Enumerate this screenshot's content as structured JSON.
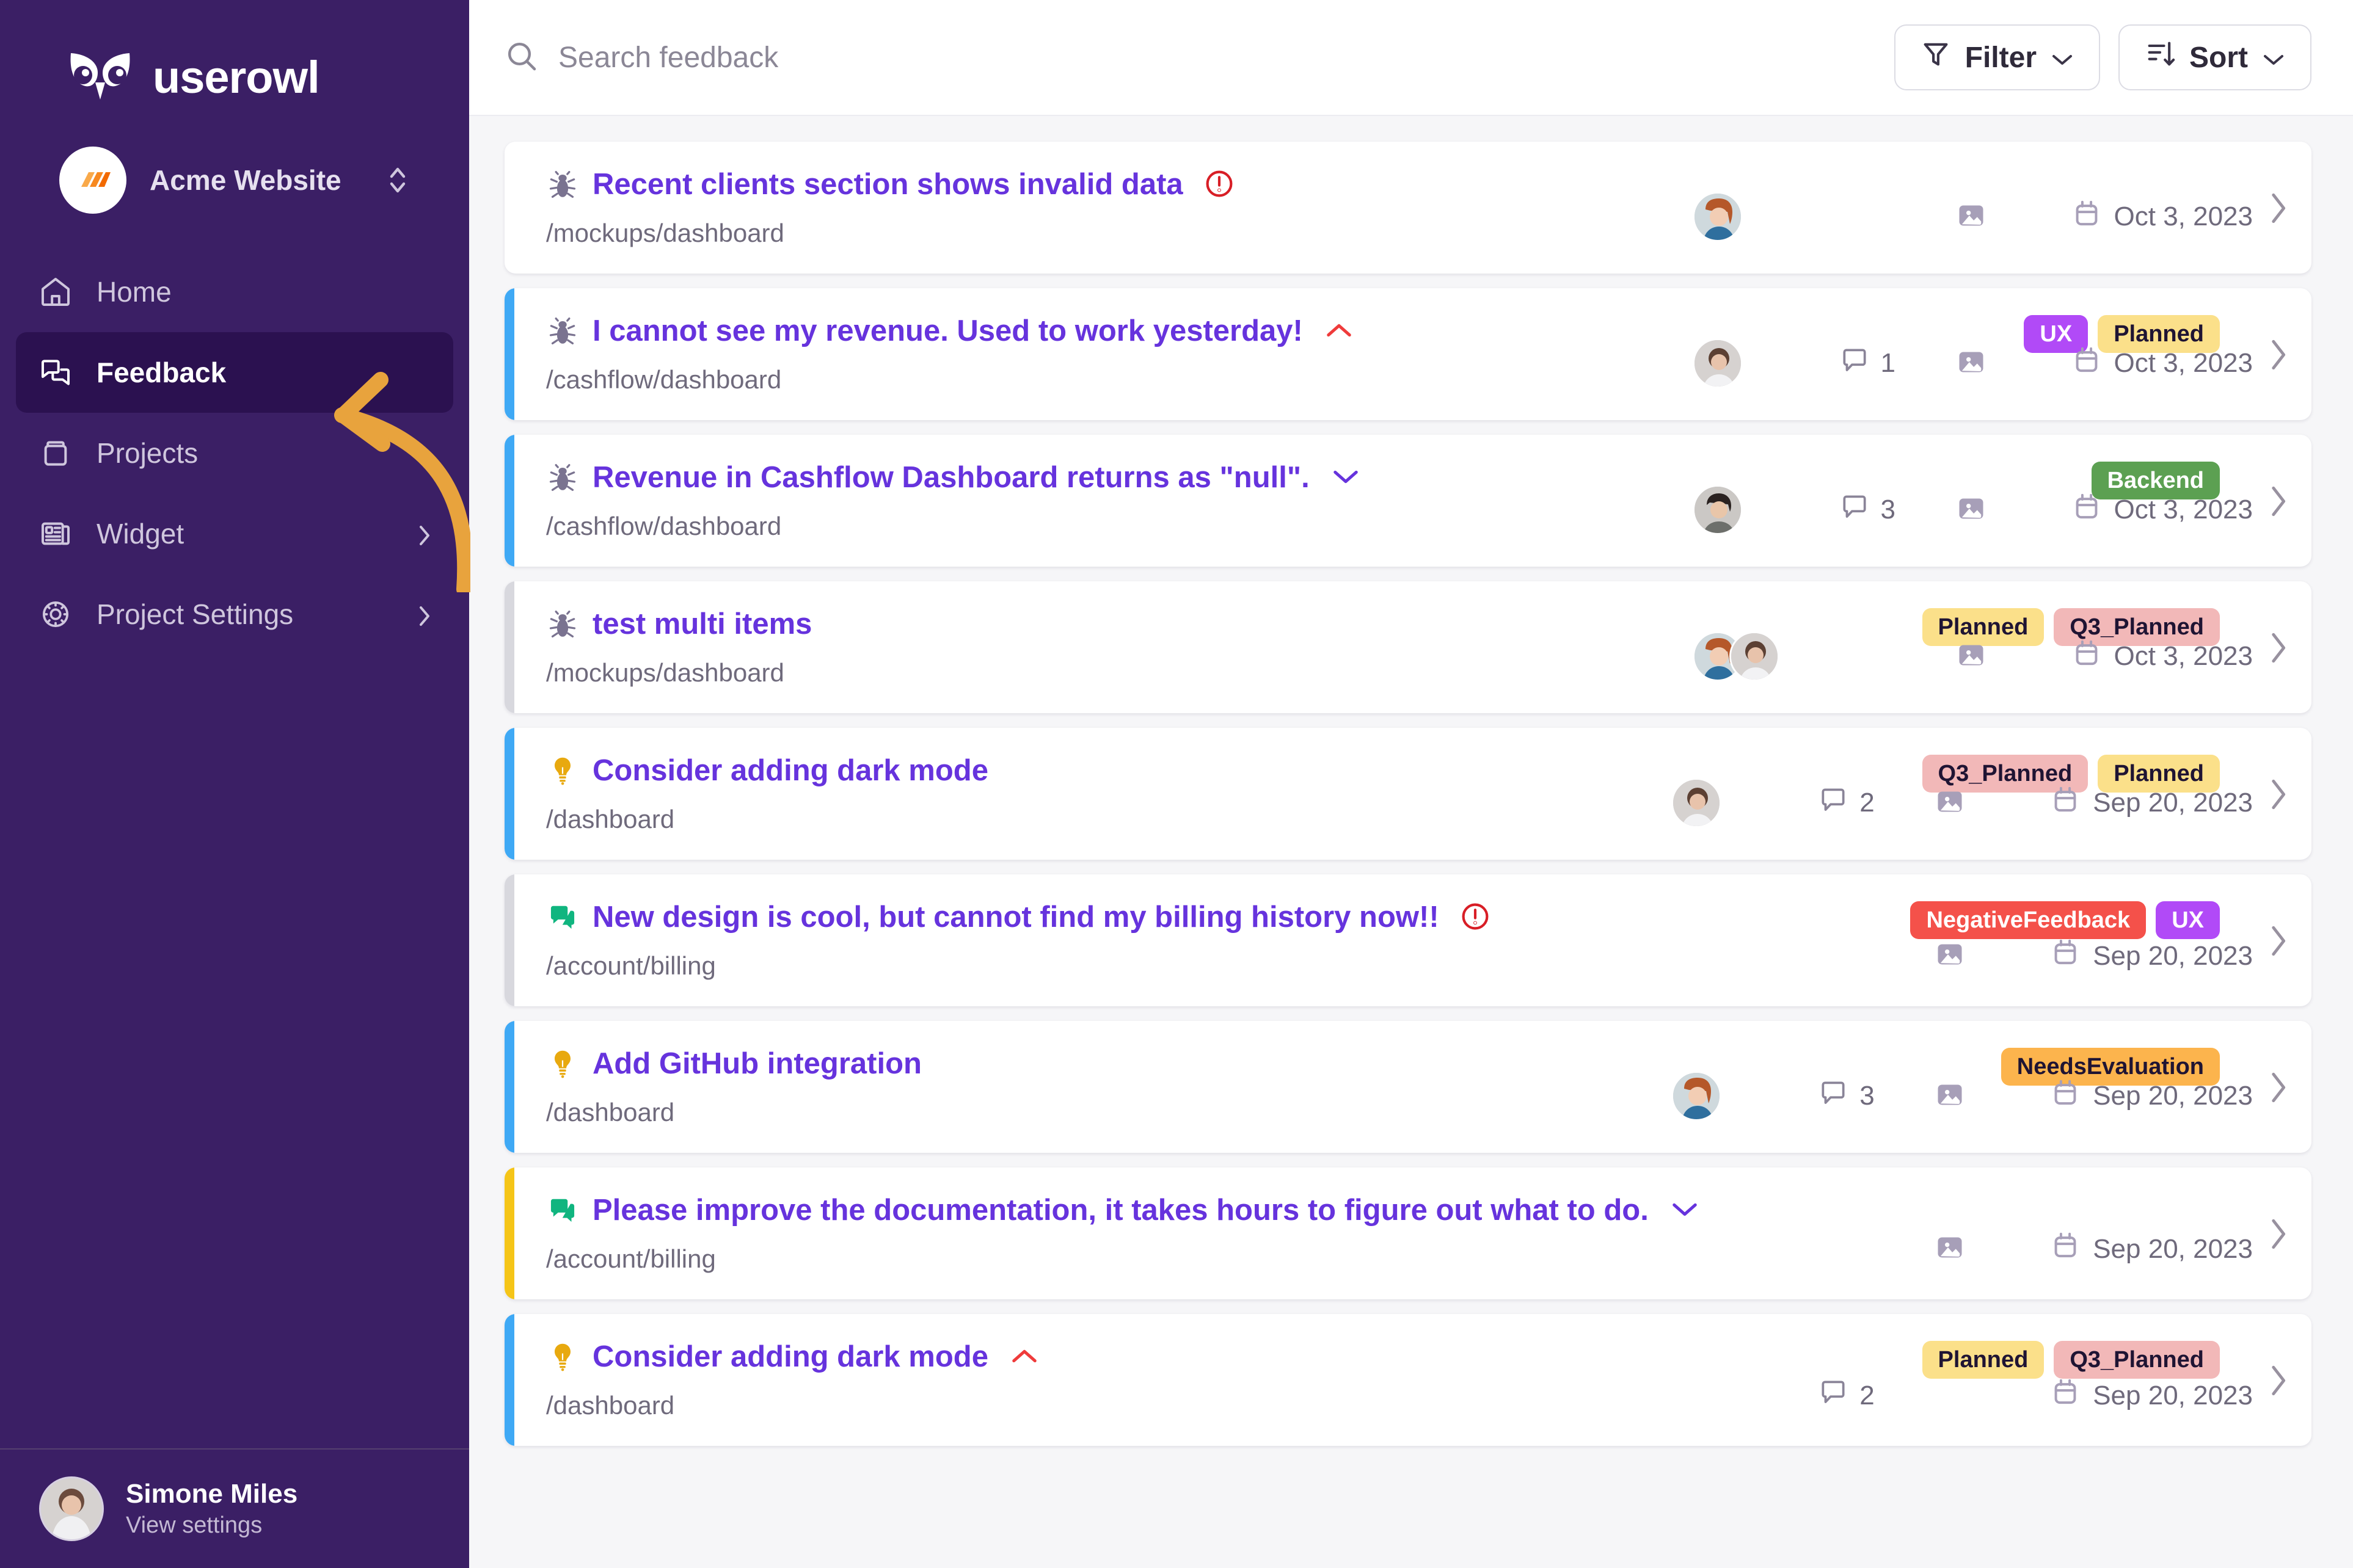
{
  "brand": {
    "name": "userowl",
    "logo_icon": "owl-logo"
  },
  "project_switcher": {
    "name": "Acme Website",
    "icon": "project-avatar-icon",
    "chevrons_icon": "chevron-up-down-icon"
  },
  "sidebar": {
    "items": [
      {
        "label": "Home",
        "icon": "home-icon",
        "active": false,
        "has_caret": false
      },
      {
        "label": "Feedback",
        "icon": "feedback-chat-icon",
        "active": true,
        "has_caret": false
      },
      {
        "label": "Projects",
        "icon": "projects-box-icon",
        "active": false,
        "has_caret": false
      },
      {
        "label": "Widget",
        "icon": "widget-card-icon",
        "active": false,
        "has_caret": true
      },
      {
        "label": "Project Settings",
        "icon": "gear-icon",
        "active": false,
        "has_caret": true
      }
    ]
  },
  "user": {
    "name": "Simone Miles",
    "subtitle": "View settings",
    "avatar_icon": "user-avatar"
  },
  "topbar": {
    "search_placeholder": "Search feedback",
    "search_value": "",
    "search_icon": "search-icon",
    "filter_label": "Filter",
    "filter_icon": "filter-funnel-icon",
    "sort_label": "Sort",
    "sort_icon": "sort-arrow-icon",
    "chevron_icon": "chevron-down-icon"
  },
  "colors": {
    "sidebar_bg": "#3b1f65",
    "sidebar_active_bg": "#2b1150",
    "title_purple": "#6633dd",
    "accent_blue": "#3fa9f5",
    "accent_yellow": "#f5c518",
    "accent_grey": "#d8d8de",
    "annotation_arrow": "#e8a33d"
  },
  "tag_styles": {
    "UX": {
      "bg": "#b14af7",
      "fg": "#ffffff"
    },
    "Planned": {
      "bg": "#fbe08a",
      "fg": "#1f1433"
    },
    "Backend": {
      "bg": "#5ca052",
      "fg": "#ffffff"
    },
    "Q3_Planned": {
      "bg": "#f2b8b8",
      "fg": "#1f1433"
    },
    "NegativeFeedback": {
      "bg": "#f4514a",
      "fg": "#ffffff"
    },
    "NeedsEvaluation": {
      "bg": "#fcb44d",
      "fg": "#1f1433"
    }
  },
  "feedback_items": [
    {
      "title": "Recent clients section shows invalid data",
      "type_icon": "bug-icon",
      "path": "/mockups/dashboard",
      "accent": "none",
      "alert": true,
      "priority_chevron": "none",
      "tags": [],
      "avatars": 1,
      "comments": null,
      "has_image": true,
      "date": "Oct 3, 2023"
    },
    {
      "title": "I cannot see my revenue. Used to work yesterday!",
      "type_icon": "bug-icon",
      "path": "/cashflow/dashboard",
      "accent": "blue",
      "alert": false,
      "priority_chevron": "up-red",
      "tags": [
        "UX",
        "Planned"
      ],
      "avatars": 1,
      "comments": "1",
      "has_image": true,
      "date": "Oct 3, 2023"
    },
    {
      "title": "Revenue in Cashflow Dashboard returns as \"null\".",
      "type_icon": "bug-icon",
      "path": "/cashflow/dashboard",
      "accent": "blue",
      "alert": false,
      "priority_chevron": "down-purple",
      "tags": [
        "Backend"
      ],
      "avatars": 1,
      "comments": "3",
      "has_image": true,
      "date": "Oct 3, 2023"
    },
    {
      "title": "test multi items",
      "type_icon": "bug-icon",
      "path": "/mockups/dashboard",
      "accent": "grey",
      "alert": false,
      "priority_chevron": "none",
      "tags": [
        "Planned",
        "Q3_Planned"
      ],
      "avatars": 2,
      "comments": null,
      "has_image": true,
      "date": "Oct 3, 2023"
    },
    {
      "title": "Consider adding dark mode",
      "type_icon": "idea-bulb-icon",
      "path": "/dashboard",
      "accent": "blue",
      "alert": false,
      "priority_chevron": "none",
      "tags": [
        "Q3_Planned",
        "Planned"
      ],
      "avatars": 1,
      "comments": "2",
      "has_image": true,
      "date": "Sep 20, 2023"
    },
    {
      "title": "New design is cool, but cannot find my billing history now!!",
      "type_icon": "comment-green-icon",
      "path": "/account/billing",
      "accent": "grey",
      "alert": true,
      "priority_chevron": "none",
      "tags": [
        "NegativeFeedback",
        "UX"
      ],
      "avatars": 0,
      "comments": null,
      "has_image": true,
      "date": "Sep 20, 2023"
    },
    {
      "title": "Add GitHub integration",
      "type_icon": "idea-bulb-icon",
      "path": "/dashboard",
      "accent": "blue",
      "alert": false,
      "priority_chevron": "none",
      "tags": [
        "NeedsEvaluation"
      ],
      "avatars": 1,
      "comments": "3",
      "has_image": true,
      "date": "Sep 20, 2023"
    },
    {
      "title": "Please improve the documentation, it takes hours to figure out what to do.",
      "type_icon": "comment-green-icon",
      "path": "/account/billing",
      "accent": "yellow",
      "alert": false,
      "priority_chevron": "down-purple",
      "tags": [],
      "avatars": 0,
      "comments": null,
      "has_image": true,
      "date": "Sep 20, 2023"
    },
    {
      "title": "Consider adding dark mode",
      "type_icon": "idea-bulb-icon",
      "path": "/dashboard",
      "accent": "blue",
      "alert": false,
      "priority_chevron": "up-red",
      "tags": [
        "Planned",
        "Q3_Planned"
      ],
      "avatars": 0,
      "comments": "2",
      "has_image": false,
      "date": "Sep 20, 2023"
    }
  ]
}
